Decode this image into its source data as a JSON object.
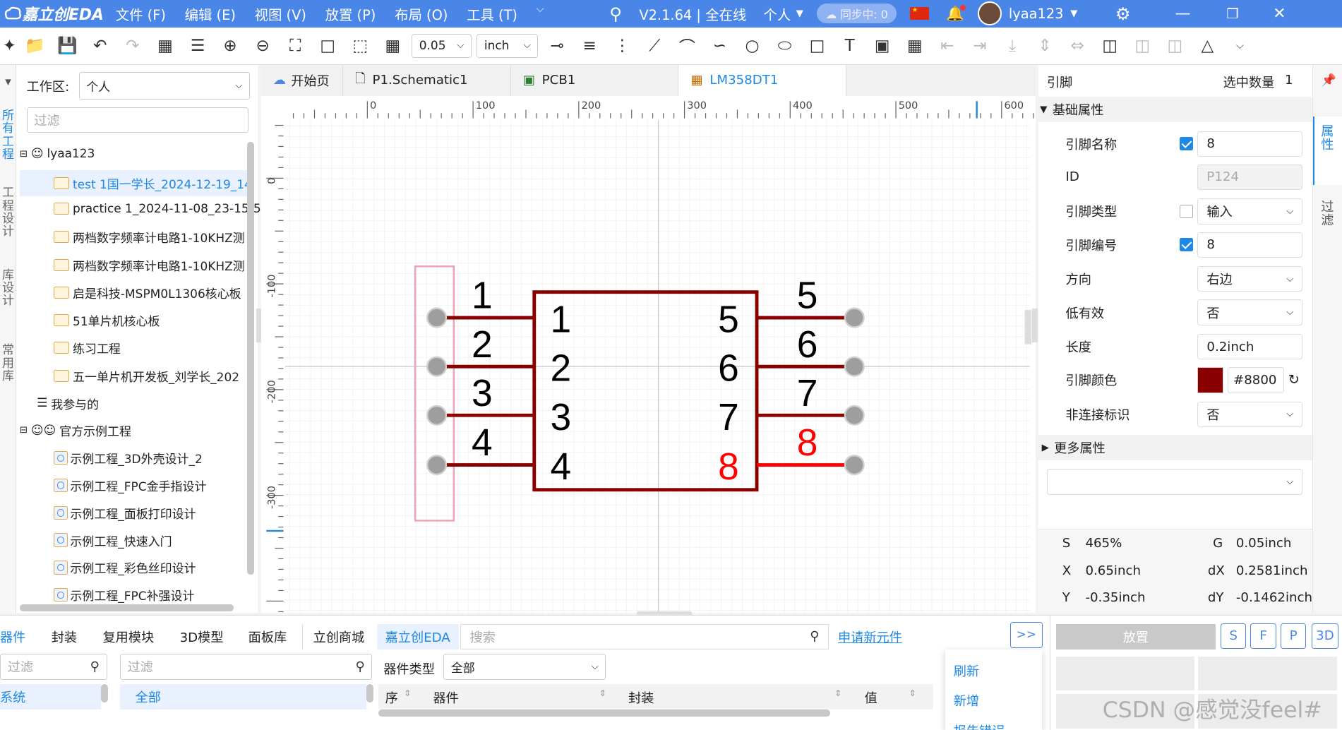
{
  "topbar": {
    "logo": "嘉立创EDA",
    "menu": [
      "文件 (F)",
      "编辑 (E)",
      "视图 (V)",
      "放置 (P)",
      "布局 (O)",
      "工具 (T)"
    ],
    "version": "V2.1.64 | 全在线",
    "workspace": "个人",
    "sync": "同步中: 0",
    "user": "lyaa123"
  },
  "toolbar": {
    "grid": "0.05",
    "unit": "inch"
  },
  "leftstrip": [
    "所有工程",
    "工程设计",
    "库设计",
    "常用库"
  ],
  "leftpanel": {
    "workspace_label": "工作区:",
    "workspace_value": "个人",
    "filter_placeholder": "过滤",
    "user_node": "lyaa123",
    "projects": [
      "test 1国一学长_2024-12-19_14",
      "practice 1_2024-11-08_23-15-5",
      "两档数字频率计电路1-10KHZ测",
      "两档数字频率计电路1-10KHZ测",
      "启是科技-MSPM0L1306核心板",
      "51单片机核心板",
      "练习工程",
      "五一单片机开发板_刘学长_202"
    ],
    "participated": "我参与的",
    "official": "官方示例工程",
    "examples": [
      "示例工程_3D外壳设计_2",
      "示例工程_FPC金手指设计",
      "示例工程_面板打印设计",
      "示例工程_快速入门",
      "示例工程_彩色丝印设计",
      "示例工程_FPC补强设计"
    ]
  },
  "tabs": [
    {
      "label": "开始页"
    },
    {
      "label": "P1.Schematic1"
    },
    {
      "label": "PCB1"
    },
    {
      "label": "LM358DT1"
    }
  ],
  "ruler": {
    "top": [
      "0",
      "100",
      "200",
      "300",
      "400",
      "500",
      "600"
    ],
    "left": [
      "0",
      "-100",
      "-200",
      "-300"
    ]
  },
  "symbol": {
    "pin_color": "#880000",
    "selected_color": "#ff0000",
    "left_pins": [
      {
        "name": "1",
        "number": "1"
      },
      {
        "name": "2",
        "number": "2"
      },
      {
        "name": "3",
        "number": "3"
      },
      {
        "name": "4",
        "number": "4"
      }
    ],
    "right_pins": [
      {
        "name": "5",
        "number": "5"
      },
      {
        "name": "6",
        "number": "6"
      },
      {
        "name": "7",
        "number": "7"
      },
      {
        "name": "8",
        "number": "8",
        "selected": true
      }
    ]
  },
  "props": {
    "header": "引脚",
    "selected_count_label": "选中数量",
    "selected_count": "1",
    "section_basic": "基础属性",
    "pin_name_label": "引脚名称",
    "pin_name": "8",
    "id_label": "ID",
    "id": "P124",
    "pin_type_label": "引脚类型",
    "pin_type": "输入",
    "pin_number_label": "引脚编号",
    "pin_number": "8",
    "direction_label": "方向",
    "direction": "右边",
    "active_low_label": "低有效",
    "active_low": "否",
    "length_label": "长度",
    "length": "0.2inch",
    "color_label": "引脚颜色",
    "color_value": "#8800",
    "noconnect_label": "非连接标识",
    "noconnect": "否",
    "section_more": "更多属性"
  },
  "rightstrip": [
    "属性",
    "过滤"
  ],
  "status": {
    "s_label": "S",
    "s": "465%",
    "g_label": "G",
    "g": "0.05inch",
    "x_label": "X",
    "x": "0.65inch",
    "dx_label": "dX",
    "dx": "0.2581inch",
    "y_label": "Y",
    "y": "-0.35inch",
    "dy_label": "dY",
    "dy": "-0.1462inch"
  },
  "bottom": {
    "tabs": [
      "器件",
      "封装",
      "复用模块",
      "3D模型",
      "面板库",
      "立创商城",
      "嘉立创EDA"
    ],
    "search_placeholder": "搜索",
    "apply_link": "申请新元件",
    "expand": ">>",
    "filter1": "过滤",
    "filter2": "过滤",
    "category_label": "器件类型",
    "category_value": "全部",
    "tree_system": "系统",
    "tree_all": "全部",
    "cols": [
      "序",
      "器件",
      "封装",
      "值"
    ],
    "menu": [
      "刷新",
      "新增",
      "报告错误"
    ],
    "place": "放置",
    "view_buttons": [
      "S",
      "F",
      "P",
      "3D"
    ],
    "watermark": "CSDN @感觉没feel#"
  }
}
